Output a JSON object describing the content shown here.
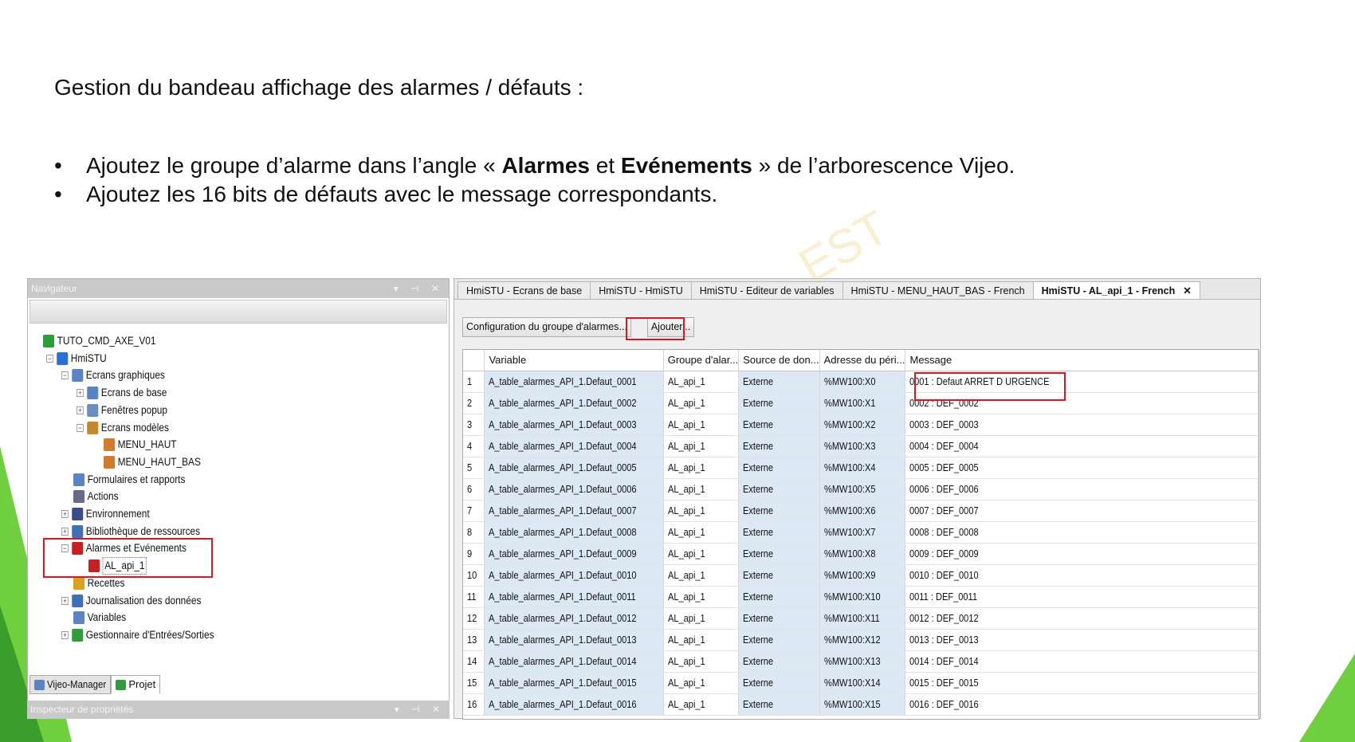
{
  "slide": {
    "title": "Gestion du bandeau affichage des alarmes / défauts :",
    "bullet1_pre": "Ajoutez le groupe d’alarme dans l’angle « ",
    "bullet1_bold1": "Alarmes",
    "bullet1_mid": " et ",
    "bullet1_bold2": "Evénements",
    "bullet1_post": " » de l’arborescence Vijeo.",
    "bullet2": "Ajoutez les 16 bits de défauts avec le message correspondants.",
    "watermark": "EST"
  },
  "navigator": {
    "title": "Navigateur",
    "controls": "▾ ⊣ ✕",
    "tree": [
      {
        "label": "TUTO_CMD_AXE_V01",
        "icon": "project-icon",
        "color": "#2e9d3a"
      },
      {
        "label": "HmiSTU",
        "icon": "terminal-icon",
        "color": "#2a6fd4"
      },
      {
        "label": "Ecrans graphiques",
        "icon": "screens-icon",
        "color": "#5b84c4"
      },
      {
        "label": "Ecrans de base",
        "icon": "screens-icon",
        "color": "#5b84c4"
      },
      {
        "label": "Fenêtres popup",
        "icon": "popup-icon",
        "color": "#6c8fbf"
      },
      {
        "label": "Ecrans modèles",
        "icon": "template-icon",
        "color": "#c7882a"
      },
      {
        "label": "MENU_HAUT",
        "icon": "screen-page-icon",
        "color": "#d07c2c"
      },
      {
        "label": "MENU_HAUT_BAS",
        "icon": "screen-page-icon",
        "color": "#d07c2c"
      },
      {
        "label": "Formulaires et rapports",
        "icon": "forms-icon",
        "color": "#5b84c4"
      },
      {
        "label": "Actions",
        "icon": "actions-icon",
        "color": "#6a6a8a"
      },
      {
        "label": "Environnement",
        "icon": "environment-icon",
        "color": "#3b4e8a"
      },
      {
        "label": "Bibliothèque de ressources",
        "icon": "library-icon",
        "color": "#3f6fb5"
      },
      {
        "label": "Alarmes et Evénements",
        "icon": "alarm-icon",
        "color": "#c62020"
      },
      {
        "label": "AL_api_1",
        "icon": "alarm-bell-icon",
        "color": "#c62020"
      },
      {
        "label": "Recettes",
        "icon": "recipe-icon",
        "color": "#d8a21e"
      },
      {
        "label": "Journalisation des données",
        "icon": "logging-icon",
        "color": "#3f6fb5"
      },
      {
        "label": "Variables",
        "icon": "variables-icon",
        "color": "#5b84c4"
      },
      {
        "label": "Gestionnaire d'Entrées/Sorties",
        "icon": "io-manager-icon",
        "color": "#2e9d3a"
      }
    ],
    "bottom_tabs": [
      "Vijeo-Manager",
      "Projet"
    ]
  },
  "inspector": {
    "title": "Inspecteur de propriétés",
    "controls": "▾ ⊣ ✕"
  },
  "editor": {
    "tabs": [
      "HmiSTU - Ecrans de base",
      "HmiSTU - HmiSTU",
      "HmiSTU - Editeur de variables",
      "HmiSTU - MENU_HAUT_BAS - French",
      "HmiSTU - AL_api_1 - French"
    ],
    "close_glyph": "✕",
    "config_button": "Configuration du groupe d'alarmes...",
    "add_button": "Ajouter...",
    "columns": [
      "",
      "Variable",
      "Groupe d'alar...",
      "Source de don...",
      "Adresse du péri...",
      "Message"
    ],
    "rows": [
      [
        "1",
        "A_table_alarmes_API_1.Defaut_0001",
        "AL_api_1",
        "Externe",
        "%MW100:X0",
        "0001 : Defaut ARRET D URGENCE"
      ],
      [
        "2",
        "A_table_alarmes_API_1.Defaut_0002",
        "AL_api_1",
        "Externe",
        "%MW100:X1",
        "0002 : DEF_0002"
      ],
      [
        "3",
        "A_table_alarmes_API_1.Defaut_0003",
        "AL_api_1",
        "Externe",
        "%MW100:X2",
        "0003 : DEF_0003"
      ],
      [
        "4",
        "A_table_alarmes_API_1.Defaut_0004",
        "AL_api_1",
        "Externe",
        "%MW100:X3",
        "0004 : DEF_0004"
      ],
      [
        "5",
        "A_table_alarmes_API_1.Defaut_0005",
        "AL_api_1",
        "Externe",
        "%MW100:X4",
        "0005 : DEF_0005"
      ],
      [
        "6",
        "A_table_alarmes_API_1.Defaut_0006",
        "AL_api_1",
        "Externe",
        "%MW100:X5",
        "0006 : DEF_0006"
      ],
      [
        "7",
        "A_table_alarmes_API_1.Defaut_0007",
        "AL_api_1",
        "Externe",
        "%MW100:X6",
        "0007 : DEF_0007"
      ],
      [
        "8",
        "A_table_alarmes_API_1.Defaut_0008",
        "AL_api_1",
        "Externe",
        "%MW100:X7",
        "0008 : DEF_0008"
      ],
      [
        "9",
        "A_table_alarmes_API_1.Defaut_0009",
        "AL_api_1",
        "Externe",
        "%MW100:X8",
        "0009 : DEF_0009"
      ],
      [
        "10",
        "A_table_alarmes_API_1.Defaut_0010",
        "AL_api_1",
        "Externe",
        "%MW100:X9",
        "0010 : DEF_0010"
      ],
      [
        "11",
        "A_table_alarmes_API_1.Defaut_0011",
        "AL_api_1",
        "Externe",
        "%MW100:X10",
        "0011 : DEF_0011"
      ],
      [
        "12",
        "A_table_alarmes_API_1.Defaut_0012",
        "AL_api_1",
        "Externe",
        "%MW100:X11",
        "0012 : DEF_0012"
      ],
      [
        "13",
        "A_table_alarmes_API_1.Defaut_0013",
        "AL_api_1",
        "Externe",
        "%MW100:X12",
        "0013 : DEF_0013"
      ],
      [
        "14",
        "A_table_alarmes_API_1.Defaut_0014",
        "AL_api_1",
        "Externe",
        "%MW100:X13",
        "0014 : DEF_0014"
      ],
      [
        "15",
        "A_table_alarmes_API_1.Defaut_0015",
        "AL_api_1",
        "Externe",
        "%MW100:X14",
        "0015 : DEF_0015"
      ],
      [
        "16",
        "A_table_alarmes_API_1.Defaut_0016",
        "AL_api_1",
        "Externe",
        "%MW100:X15",
        "0016 : DEF_0016"
      ]
    ]
  },
  "colors": {
    "highlight_red": "#e0141e",
    "accent_green": "#6fcf3f",
    "cell_blue": "#dde8f5"
  }
}
